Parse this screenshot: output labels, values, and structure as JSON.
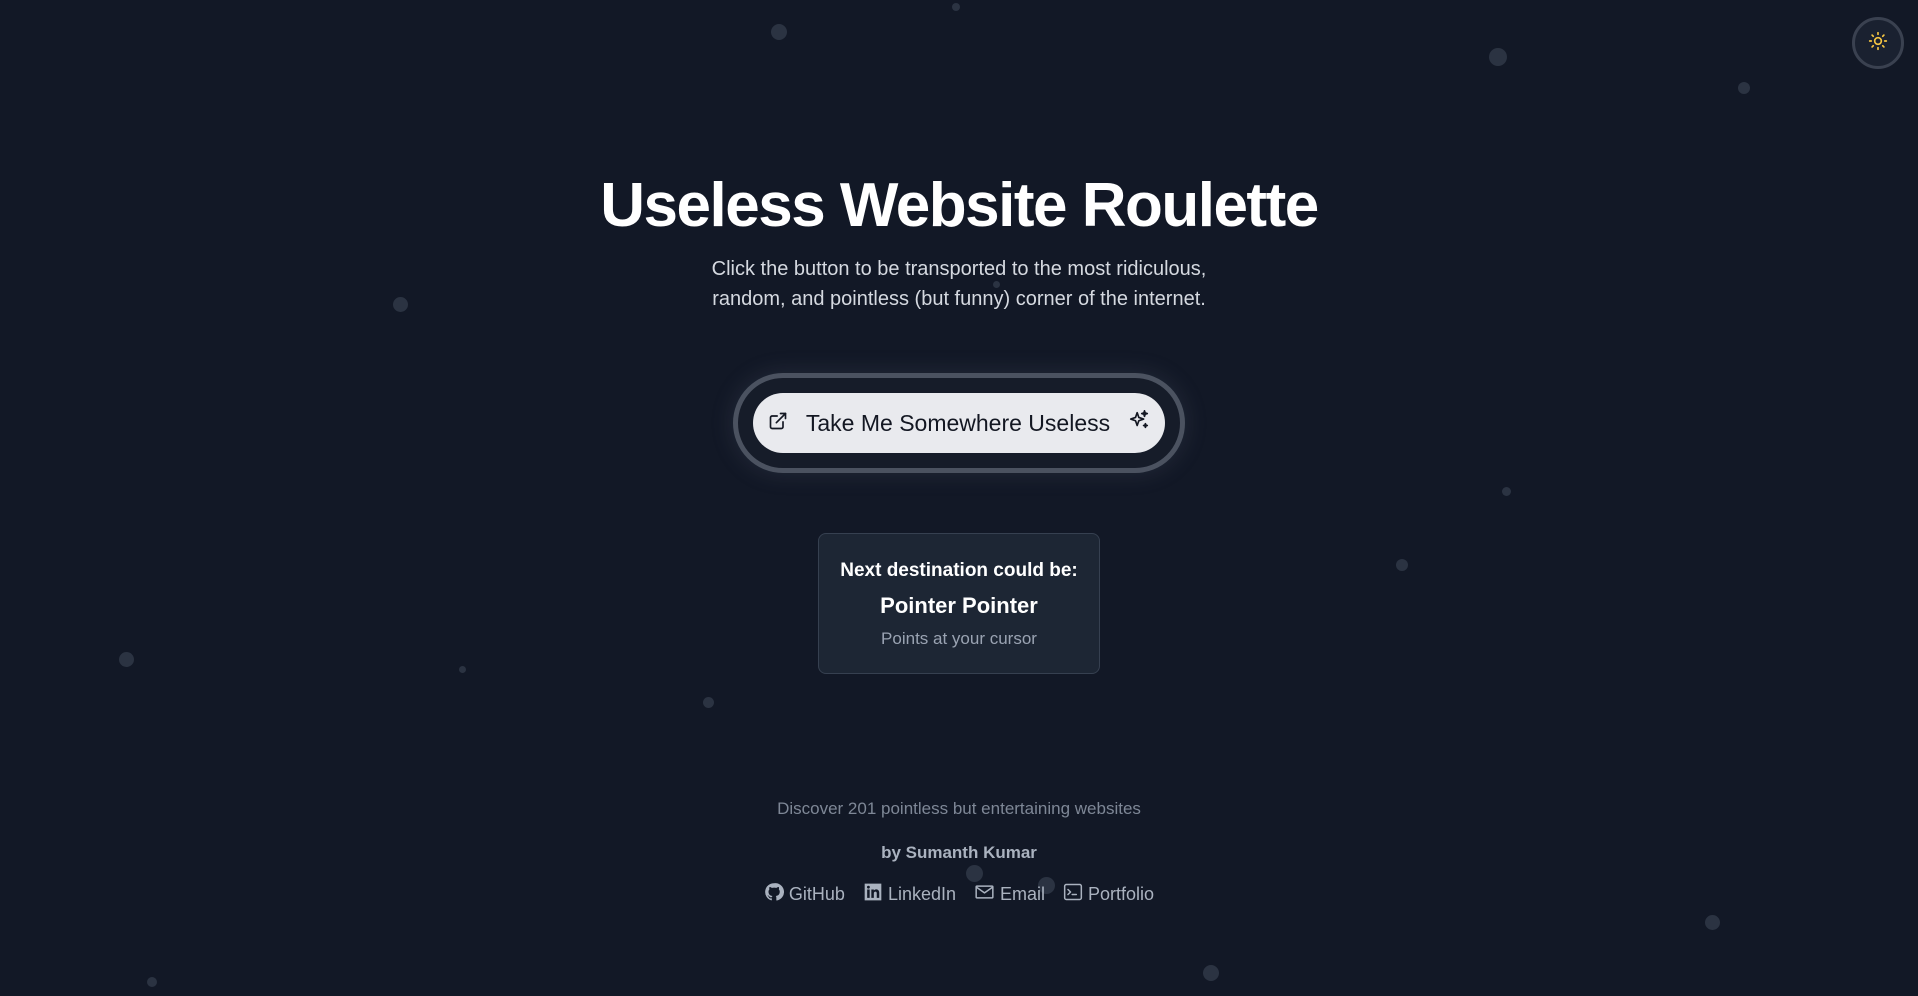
{
  "colors": {
    "background": "#121826",
    "button_bg": "#e9eaee",
    "card_bg": "#1d2634",
    "sun_icon": "#f5c542"
  },
  "theme_toggle": {
    "icon": "sun-icon"
  },
  "hero": {
    "title": "Useless Website Roulette",
    "subtitle": "Click the button to be transported to the most ridiculous, random, and pointless (but funny) corner of the internet."
  },
  "cta": {
    "label": "Take Me Somewhere Useless",
    "left_icon": "external-link-icon",
    "right_icon": "sparkles-icon"
  },
  "preview": {
    "label": "Next destination could be:",
    "name": "Pointer Pointer",
    "description": "Points at your cursor"
  },
  "footer": {
    "discover": "Discover 201 pointless but entertaining websites",
    "author": "by Sumanth Kumar",
    "links": [
      {
        "label": "GitHub",
        "icon": "github-icon"
      },
      {
        "label": "LinkedIn",
        "icon": "linkedin-icon"
      },
      {
        "label": "Email",
        "icon": "mail-icon"
      },
      {
        "label": "Portfolio",
        "icon": "terminal-icon"
      }
    ]
  }
}
